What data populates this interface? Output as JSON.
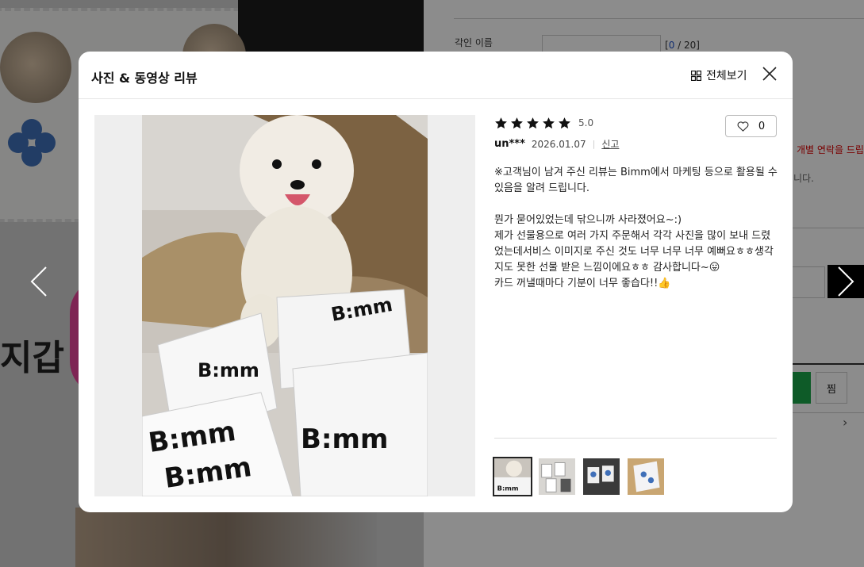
{
  "background": {
    "side_word": "지갑",
    "engraving_label": "각인 이름",
    "engraving_counter_current": "0",
    "engraving_counter_max": " / 20]",
    "engraving_counter_open": "[",
    "notice_red": "개별 연락을 드립",
    "notice_gray": "니다.",
    "wishlist_label": "찜"
  },
  "modal": {
    "title": "사진 & 동영상 리뷰",
    "view_all_label": "전체보기",
    "close_label": "닫기"
  },
  "review": {
    "score": "5.0",
    "stars": 5,
    "author": "un***",
    "date": "2026.01.07",
    "report_label": "신고",
    "like_count": "0",
    "body": "※고객님이 남겨 주신 리뷰는 Bimm에서 마케팅 등으로 활용될 수 있음을 알려 드립니다.\n\n뭔가 묻어있었는데 닦으니까 사라졌어요~:)\n제가 선물용으로 여러 가지 주문해서 각각 사진을 많이 보내 드렸었는데서비스 이미지로 주신 것도 너무 너무 너무 예뻐요ㅎㅎ생각지도 못한 선물 받은 느낌이에요ㅎㅎ 감사합니다~😛\n카드 꺼낼때마다 기분이 너무 좋습다!!👍"
  },
  "photo": {
    "brand_text": "B:mm"
  },
  "thumbnails": [
    {
      "name": "thumb-dog-boxes",
      "active": true
    },
    {
      "name": "thumb-cards-1",
      "active": false
    },
    {
      "name": "thumb-cards-2",
      "active": false
    },
    {
      "name": "thumb-cards-3",
      "active": false
    }
  ],
  "colors": {
    "accent_dark": "#111111",
    "star": "#111111",
    "notice_red": "#dd0000",
    "counter_blue": "#2255cc",
    "buy_green": "#1aa64a"
  }
}
